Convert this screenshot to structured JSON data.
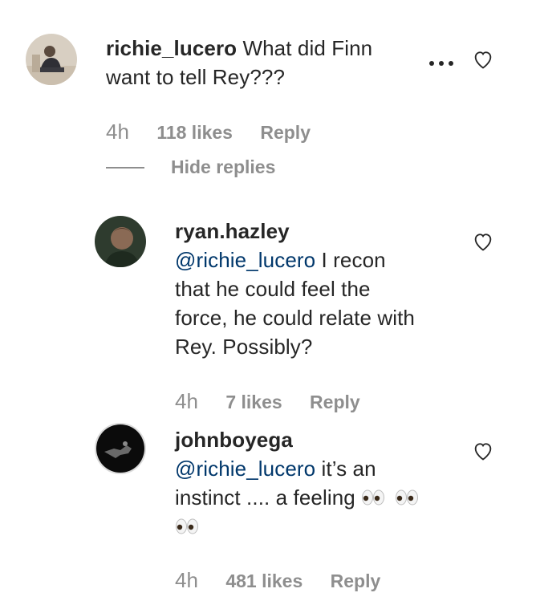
{
  "comment1": {
    "username": "richie_lucero",
    "text_line1": "What did Finn",
    "text_line2": "want to tell Rey???",
    "time": "4h",
    "likes": "118 likes",
    "reply": "Reply",
    "hide_replies": "Hide replies"
  },
  "reply1": {
    "username": "ryan.hazley",
    "mention": "@richie_lucero",
    "text_line1": " I recon",
    "text_line2": "that he could feel the",
    "text_line3": "force, he could relate with",
    "text_line4": "Rey. Possibly?",
    "time": "4h",
    "likes": "7 likes",
    "reply": "Reply"
  },
  "reply2": {
    "username": "johnboyega",
    "mention": "@richie_lucero",
    "text_line1": " it’s an",
    "text_line2": "instinct .... a feeling",
    "time": "4h",
    "likes": "481 likes",
    "reply": "Reply"
  },
  "icons": {
    "more": "more-options-icon",
    "heart": "heart-outline-icon",
    "eyes": "eyes-emoji"
  },
  "colors": {
    "text": "#262626",
    "muted": "#8e8e8e",
    "mention": "#00376b"
  }
}
